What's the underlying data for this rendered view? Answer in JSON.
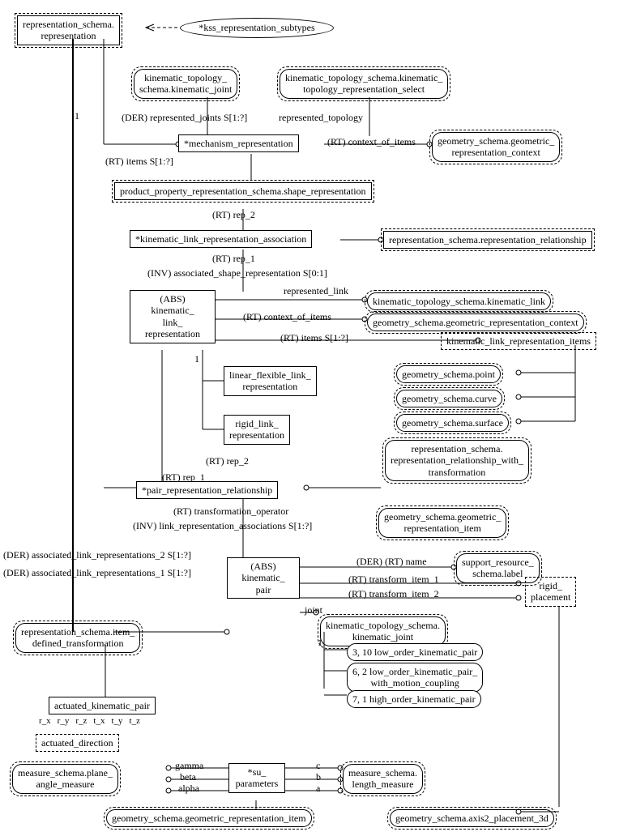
{
  "nodes": {
    "rep_schema_rep": "representation_schema.\nrepresentation",
    "kss_rep_subtypes": "*kss_representation_subtypes",
    "kin_topo_joint": "kinematic_topology_\nschema.kinematic_joint",
    "kin_topo_rep_select": "kinematic_topology_schema.kinematic_\ntopology_representation_select",
    "mech_rep": "*mechanism_representation",
    "geom_rep_ctx": "geometry_schema.geometric_\nrepresentation_context",
    "prod_prop_shape_rep": "product_property_representation_schema.shape_representation",
    "kin_link_rep_assoc": "*kinematic_link_representation_association",
    "rep_schema_rep_rel": "representation_schema.representation_relationship",
    "abs_kin_link_rep": "(ABS)\nkinematic_\nlink_\nrepresentation",
    "kin_topo_link": "kinematic_topology_schema.kinematic_link",
    "geom_rep_ctx2": "geometry_schema.geometric_representation_context",
    "kin_link_rep_items": "kinematic_link_representation_items",
    "lin_flex_link_rep": "linear_flexible_link_\nrepresentation",
    "rigid_link_rep": "rigid_link_\nrepresentation",
    "geom_point": "geometry_schema.point",
    "geom_curve": "geometry_schema.curve",
    "geom_surface": "geometry_schema.surface",
    "rep_rel_with_trans": "representation_schema.\nrepresentation_relationship_with_\ntransformation",
    "pair_rep_rel": "*pair_representation_relationship",
    "geom_rep_item": "geometry_schema.geometric_\nrepresentation_item",
    "sup_res_label": "support_resource_\nschema.label",
    "abs_kin_pair": "(ABS)\nkinematic_\npair",
    "rigid_placement": "rigid_\nplacement",
    "item_def_trans": "representation_schema.item_\ndefined_transformation",
    "kin_topo_joint2": "kinematic_topology_schema.\nkinematic_joint",
    "low_order_pair": "3, 10 low_order_kinematic_pair",
    "low_order_pair_mc": "6, 2 low_order_kinematic_pair_\nwith_motion_coupling",
    "high_order_pair": "7, 1 high_order_kinematic_pair",
    "actuated_kin_pair": "actuated_kinematic_pair",
    "actuated_direction": "actuated_direction",
    "plane_angle": "measure_schema.plane_\nangle_measure",
    "su_params": "*su_\nparameters",
    "length_measure": "measure_schema.\nlength_measure",
    "geom_rep_item2": "geometry_schema.geometric_representation_item",
    "axis2_3d": "geometry_schema.axis2_placement_3d"
  },
  "labels": {
    "der_rep_joints": "(DER) represented_joints S[1:?]",
    "rep_topology": "represented_topology",
    "rt_ctx_items": "(RT) context_of_items",
    "rt_items": "(RT) items S[1:?]",
    "rt_rep_2": "(RT) rep_2",
    "rt_rep_1": "(RT) rep_1",
    "inv_assoc_shape": "(INV) associated_shape_representation S[0:1]",
    "rep_link": "represented_link",
    "rt_ctx_items2": "(RT) context_of_items",
    "rt_items2": "(RT) items S[1:?]",
    "rt_rep_2b": "(RT) rep_2",
    "rt_rep_1b": "(RT) rep_1",
    "rt_trans_op": "(RT) transformation_operator",
    "inv_link_rep": "(INV) link_representation_associations S[1:?]",
    "der_rt_name": "(DER) (RT) name",
    "rt_trans_1": "(RT) transform_item_1",
    "rt_trans_2": "(RT) transform_item_2",
    "joint": "joint",
    "der_assoc_2": "(DER) associated_link_representations_2 S[1:?]",
    "der_assoc_1": "(DER) associated_link_representations_1 S[1:?]",
    "rxyz": [
      "r_x",
      "r_y",
      "r_z",
      "t_x",
      "t_y",
      "t_z"
    ],
    "gamma": "gamma",
    "beta": "beta",
    "alpha": "alpha",
    "c": "c",
    "b": "b",
    "a": "a",
    "one": "1"
  }
}
